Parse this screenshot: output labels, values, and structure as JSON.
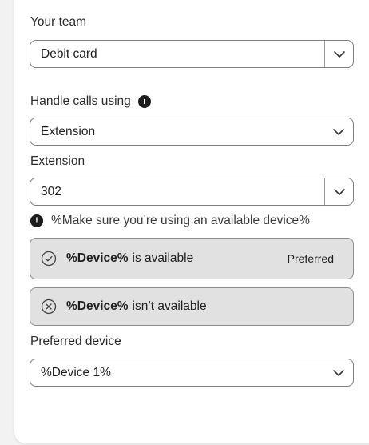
{
  "team": {
    "label": "Your team",
    "value": "Debit card"
  },
  "handle_calls": {
    "label": "Handle calls using",
    "value": "Extension"
  },
  "extension": {
    "label": "Extension",
    "value": "302"
  },
  "warning": {
    "text": "%Make sure you’re using an available device%"
  },
  "devices": [
    {
      "name": "%Device%",
      "status": "is available",
      "tag": "Preferred",
      "icon": "check-circle-icon"
    },
    {
      "name": "%Device%",
      "status": "isn’t available",
      "tag": "",
      "icon": "x-circle-icon"
    }
  ],
  "preferred_device": {
    "label": "Preferred device",
    "value": "%Device 1%"
  },
  "colors": {
    "card_bg": "#e1e1e1",
    "border": "#7d7d7d",
    "panel_bg": "#ffffff",
    "page_bg": "#f2f2f2"
  }
}
